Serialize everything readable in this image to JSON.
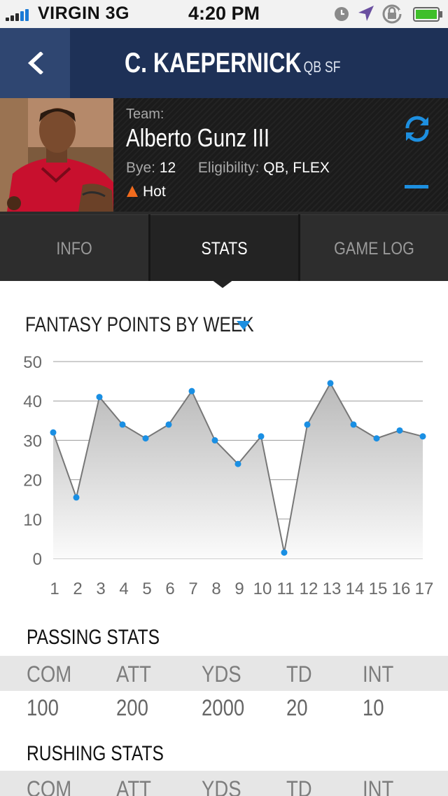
{
  "status_bar": {
    "carrier": "VIRGIN",
    "network": "3G",
    "time": "4:20 PM",
    "icons": [
      "signal-icon",
      "clock-icon",
      "location-arrow-icon",
      "rotation-lock-icon",
      "battery-icon"
    ]
  },
  "nav": {
    "back_icon": "chevron-left-icon",
    "title": "C. KAEPERNICK",
    "subtitle": "QB SF"
  },
  "player": {
    "team_label": "Team:",
    "team_name": "Alberto Gunz III",
    "bye_label": "Bye:",
    "bye_value": "12",
    "eligibility_label": "Eligibility:",
    "eligibility_value": "QB, FLEX",
    "hot_label": "Hot",
    "refresh_icon": "refresh-icon",
    "minus_icon": "minus-icon"
  },
  "tabs": [
    {
      "label": "INFO",
      "active": false
    },
    {
      "label": "STATS",
      "active": true
    },
    {
      "label": "GAME LOG",
      "active": false
    }
  ],
  "chart_section": {
    "title": "FANTASY POINTS BY WEEK",
    "dropdown_icon": "caret-down-icon"
  },
  "chart_data": {
    "type": "area",
    "title": "FANTASY POINTS BY WEEK",
    "xlabel": "",
    "ylabel": "",
    "categories": [
      "1",
      "2",
      "3",
      "4",
      "5",
      "6",
      "7",
      "8",
      "9",
      "10",
      "11",
      "12",
      "13",
      "14",
      "15",
      "16",
      "17"
    ],
    "values": [
      32,
      15.5,
      41,
      34,
      30.5,
      34,
      42.5,
      30,
      24,
      31,
      1.5,
      34,
      44.5,
      34,
      30.5,
      32.5,
      31
    ],
    "ylim": [
      0,
      50
    ],
    "yticks": [
      0,
      10,
      20,
      30,
      40,
      50
    ],
    "grid": true,
    "colors": {
      "line": "#777777",
      "point": "#1a8fe3",
      "fill_top": "#b9b9b9",
      "fill_bottom": "#fbfbfb",
      "grid": "#9c9c9c"
    }
  },
  "passing": {
    "title": "PASSING STATS",
    "headers": [
      "COM",
      "ATT",
      "YDS",
      "TD",
      "INT"
    ],
    "values": [
      "100",
      "200",
      "2000",
      "20",
      "10"
    ]
  },
  "rushing": {
    "title": "RUSHING STATS",
    "headers": [
      "COM",
      "ATT",
      "YDS",
      "TD",
      "INT"
    ]
  },
  "colors": {
    "nav_bg": "#1e3157",
    "accent_blue": "#1d8fe0",
    "hot_orange": "#f26b1d"
  }
}
